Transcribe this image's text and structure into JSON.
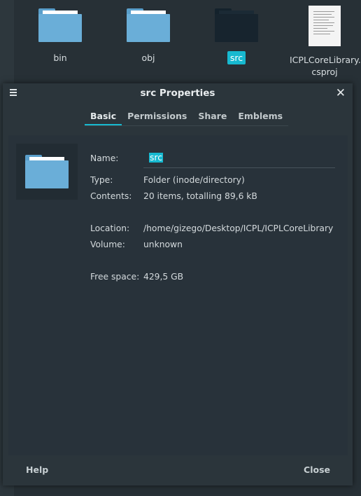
{
  "file_manager": {
    "items": [
      {
        "label": "bin"
      },
      {
        "label": "obj"
      },
      {
        "label": "src"
      },
      {
        "label_line1": "ICPLCoreLibrary.",
        "label_line2": "csproj"
      }
    ]
  },
  "dialog": {
    "title": "src Properties",
    "tabs": [
      "Basic",
      "Permissions",
      "Share",
      "Emblems"
    ],
    "fields": {
      "name_label": "Name:",
      "name_value": "src",
      "type_label": "Type:",
      "type_value": "Folder (inode/directory)",
      "contents_label": "Contents:",
      "contents_value": "20 items, totalling 89,6 kB",
      "location_label": "Location:",
      "location_value": "/home/gizego/Desktop/ICPL/ICPLCoreLibrary",
      "volume_label": "Volume:",
      "volume_value": "unknown",
      "free_label": "Free space:",
      "free_value": "429,5 GB"
    },
    "help_label": "Help",
    "close_label": "Close"
  },
  "colors": {
    "accent": "#17b9d0",
    "folder": "#6aaed8",
    "background": "#273036"
  }
}
